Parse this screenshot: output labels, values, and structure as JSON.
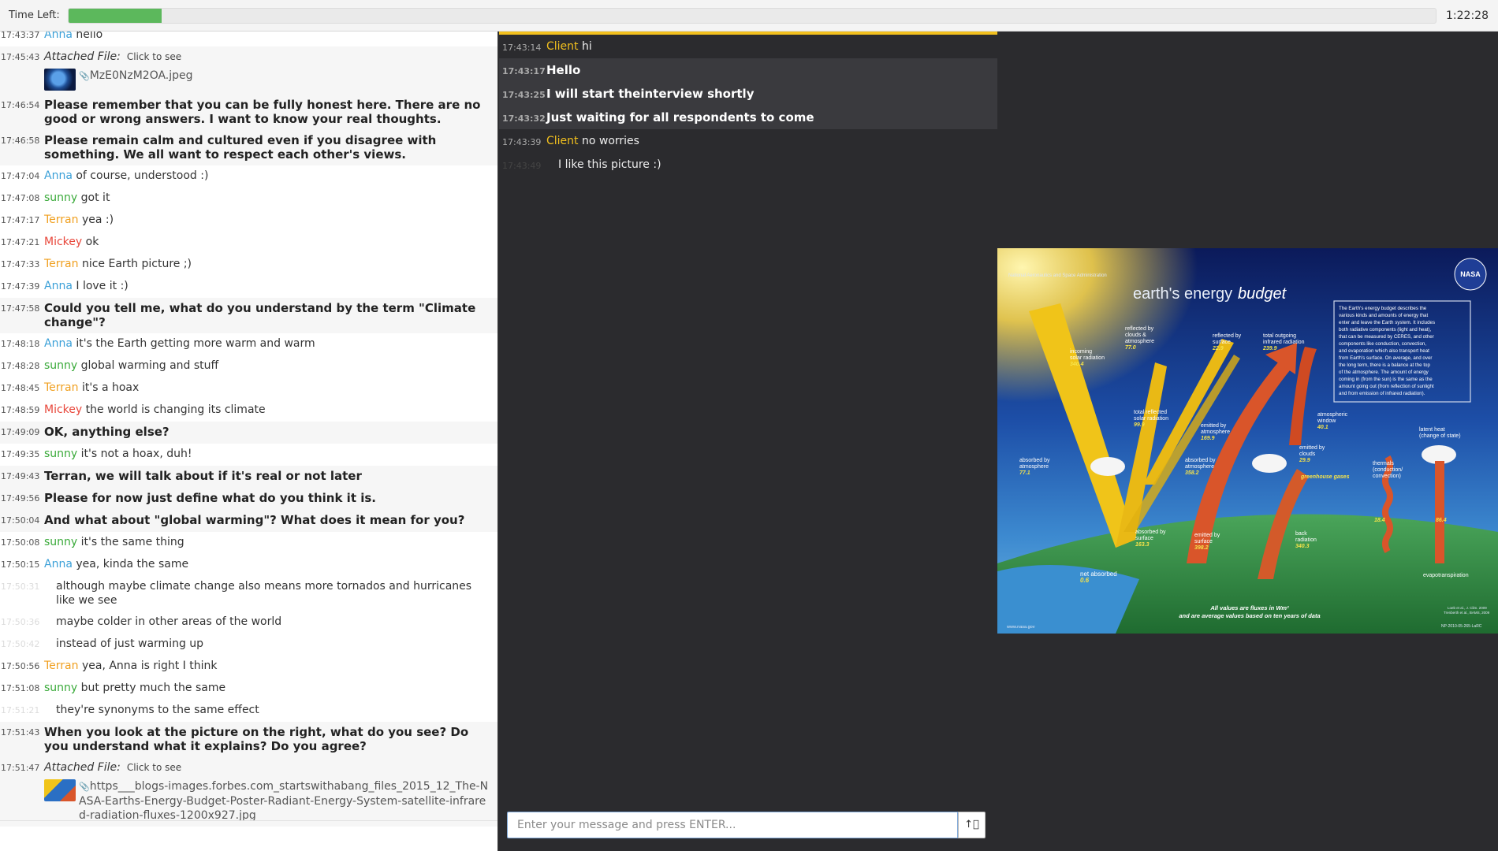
{
  "timer": {
    "label": "Time Left:",
    "remaining": "1:22:28",
    "fraction_left": 0.068
  },
  "left_chat": {
    "messages": [
      {
        "ts": "17:43:37",
        "name": "Anna",
        "text": "hello",
        "mod": false
      },
      {
        "ts": "17:45:43",
        "attachment_label": "Attached File:",
        "click": "Click to see",
        "file": "MzE0NzM2OA.jpeg",
        "mod": true
      },
      {
        "ts": "17:46:54",
        "text": "Please remember that you can be fully honest here. There are no good or wrong answers. I want to know your real thoughts.",
        "mod": true
      },
      {
        "ts": "17:46:58",
        "text": "Please remain calm and cultured even if you disagree with something. We all want to respect each other's views.",
        "mod": true
      },
      {
        "ts": "17:47:04",
        "name": "Anna",
        "text": "of course, understood :)"
      },
      {
        "ts": "17:47:08",
        "name": "sunny",
        "text": "got it"
      },
      {
        "ts": "17:47:17",
        "name": "Terran",
        "text": "yea :)"
      },
      {
        "ts": "17:47:21",
        "name": "Mickey",
        "text": "ok"
      },
      {
        "ts": "17:47:33",
        "name": "Terran",
        "text": "nice Earth picture ;)"
      },
      {
        "ts": "17:47:39",
        "name": "Anna",
        "text": "I love it :)"
      },
      {
        "ts": "17:47:58",
        "text": "Could you tell me, what do you understand by the term \"Climate change\"?",
        "mod": true
      },
      {
        "ts": "17:48:18",
        "name": "Anna",
        "text": "it's the Earth getting more warm and warm"
      },
      {
        "ts": "17:48:28",
        "name": "sunny",
        "text": "global warming and stuff"
      },
      {
        "ts": "17:48:45",
        "name": "Terran",
        "text": "it's a hoax"
      },
      {
        "ts": "17:48:59",
        "name": "Mickey",
        "text": "the world is changing its climate"
      },
      {
        "ts": "17:49:09",
        "text": "OK, anything else?",
        "mod": true
      },
      {
        "ts": "17:49:35",
        "name": "sunny",
        "text": "it's not a hoax, duh!"
      },
      {
        "ts": "17:49:43",
        "text": "Terran, we will talk about if it's real or not later",
        "mod": true
      },
      {
        "ts": "17:49:56",
        "text": "Please for now just define what do you think it is.",
        "mod": true
      },
      {
        "ts": "17:50:04",
        "text": "And what about \"global warming\"? What does it mean for you?",
        "mod": true
      },
      {
        "ts": "17:50:08",
        "name": "sunny",
        "text": "it's the same thing"
      },
      {
        "ts": "17:50:15",
        "name": "Anna",
        "text": "yea, kinda the same"
      },
      {
        "ts": "17:50:31",
        "text": "although maybe climate change also means more tornados and hurricanes like we see",
        "cont": true
      },
      {
        "ts": "17:50:36",
        "text": "maybe colder in other areas of the world",
        "cont": true
      },
      {
        "ts": "17:50:42",
        "text": "instead of just warming up",
        "cont": true
      },
      {
        "ts": "17:50:56",
        "name": "Terran",
        "text": "yea, Anna is right I think"
      },
      {
        "ts": "17:51:08",
        "name": "sunny",
        "text": "but pretty much the same"
      },
      {
        "ts": "17:51:21",
        "text": "they're synonyms to the same effect",
        "cont": true
      },
      {
        "ts": "17:51:43",
        "text": "When you look at the picture on the right, what do you see? Do you understand what it explains? Do you agree?",
        "mod": true
      },
      {
        "ts": "17:51:47",
        "attachment_label": "Attached File:",
        "click": "Click to see",
        "file": "https___blogs-images.forbes.com_startswithabang_files_2015_12_The-NASA-Earths-Energy-Budget-Poster-Radiant-Energy-System-satellite-infrared-radiation-fluxes-1200x927.jpg",
        "mod": true
      }
    ]
  },
  "name_colors": {
    "Anna": "#3ba0d8",
    "sunny": "#3aaa3a",
    "Terran": "#f0a020",
    "Mickey": "#e8463a"
  },
  "mid_chat": {
    "messages": [
      {
        "ts": "17:43:14",
        "name": "Client",
        "text": "hi"
      },
      {
        "ts": "17:43:17",
        "text": "Hello",
        "mod": true
      },
      {
        "ts": "17:43:25",
        "text": "I will start theinterview shortly",
        "mod": true
      },
      {
        "ts": "17:43:32",
        "text": "Just waiting for all respondents to come",
        "mod": true
      },
      {
        "ts": "17:43:39",
        "name": "Client",
        "text": "no worries"
      },
      {
        "ts": "17:43:49",
        "text": "I like this picture :)",
        "cont": true
      }
    ],
    "input_placeholder": "Enter your message and press ENTER...",
    "send_icon": "upload-arrow-icon"
  },
  "poster": {
    "org": "National Aeronautics and Space Administration",
    "title_a": "earth's energy",
    "title_b": "budget",
    "logo": "NASA",
    "desc": [
      "The Earth's energy budget describes the",
      "various kinds and amounts of energy that",
      "enter and leave the Earth system. It includes",
      "both radiative components (light and heat),",
      "that can be measured by CERES, and other",
      "components like conduction, convection,",
      "and evaporation which also transport heat",
      "from Earth's surface. On average, and over",
      "the long term, there is a balance at the top",
      "of the atmosphere. The amount of energy",
      "coming in (from the sun) is the same as the",
      "amount going out (from reflection of sunlight",
      "and from emission of infrared radiation)."
    ],
    "labels": {
      "incoming": [
        "incoming",
        "solar radiation",
        "340.4"
      ],
      "refl_clouds": [
        "reflected by",
        "clouds &",
        "atmosphere",
        "77.0"
      ],
      "refl_surface": [
        "reflected by",
        "surface",
        "22.9"
      ],
      "total_out": [
        "total outgoing",
        "infrared radiation",
        "239.9"
      ],
      "total_refl": [
        "total reflected",
        "solar radiation",
        "99.9"
      ],
      "emit_atmos": [
        "emitted by",
        "atmosphere",
        "169.9"
      ],
      "atm_window": [
        "atmospheric",
        "window",
        "40.1"
      ],
      "emit_clouds": [
        "emitted by",
        "clouds",
        "29.9"
      ],
      "latent": [
        "latent heat",
        "(change of state)"
      ],
      "abs_atmos_l": [
        "absorbed by",
        "atmosphere",
        "77.1"
      ],
      "abs_atmos_r": [
        "absorbed by",
        "atmosphere",
        "358.2"
      ],
      "ghg": "greenhouse gases",
      "thermals": [
        "thermals",
        "(conduction/",
        "convection)"
      ],
      "abs_surface": [
        "absorbed by",
        "surface",
        "163.3"
      ],
      "emit_surface": [
        "emitted by",
        "surface",
        "398.2"
      ],
      "back_rad": [
        "back",
        "radiation",
        "340.3"
      ],
      "v184": "18.4",
      "v864": "86.4",
      "evapo": "evapotranspiration",
      "net": [
        "net absorbed",
        "0.6"
      ],
      "footer": [
        "All values are fluxes in Wm²",
        "and are average values based on ten years of data"
      ],
      "url": "www.nasa.gov",
      "cite": [
        "Loeb et al., J. Clim. 2009",
        "Trenberth et al., BAMS, 2009"
      ],
      "code": "NP-2010-05-265-LaRC"
    }
  }
}
